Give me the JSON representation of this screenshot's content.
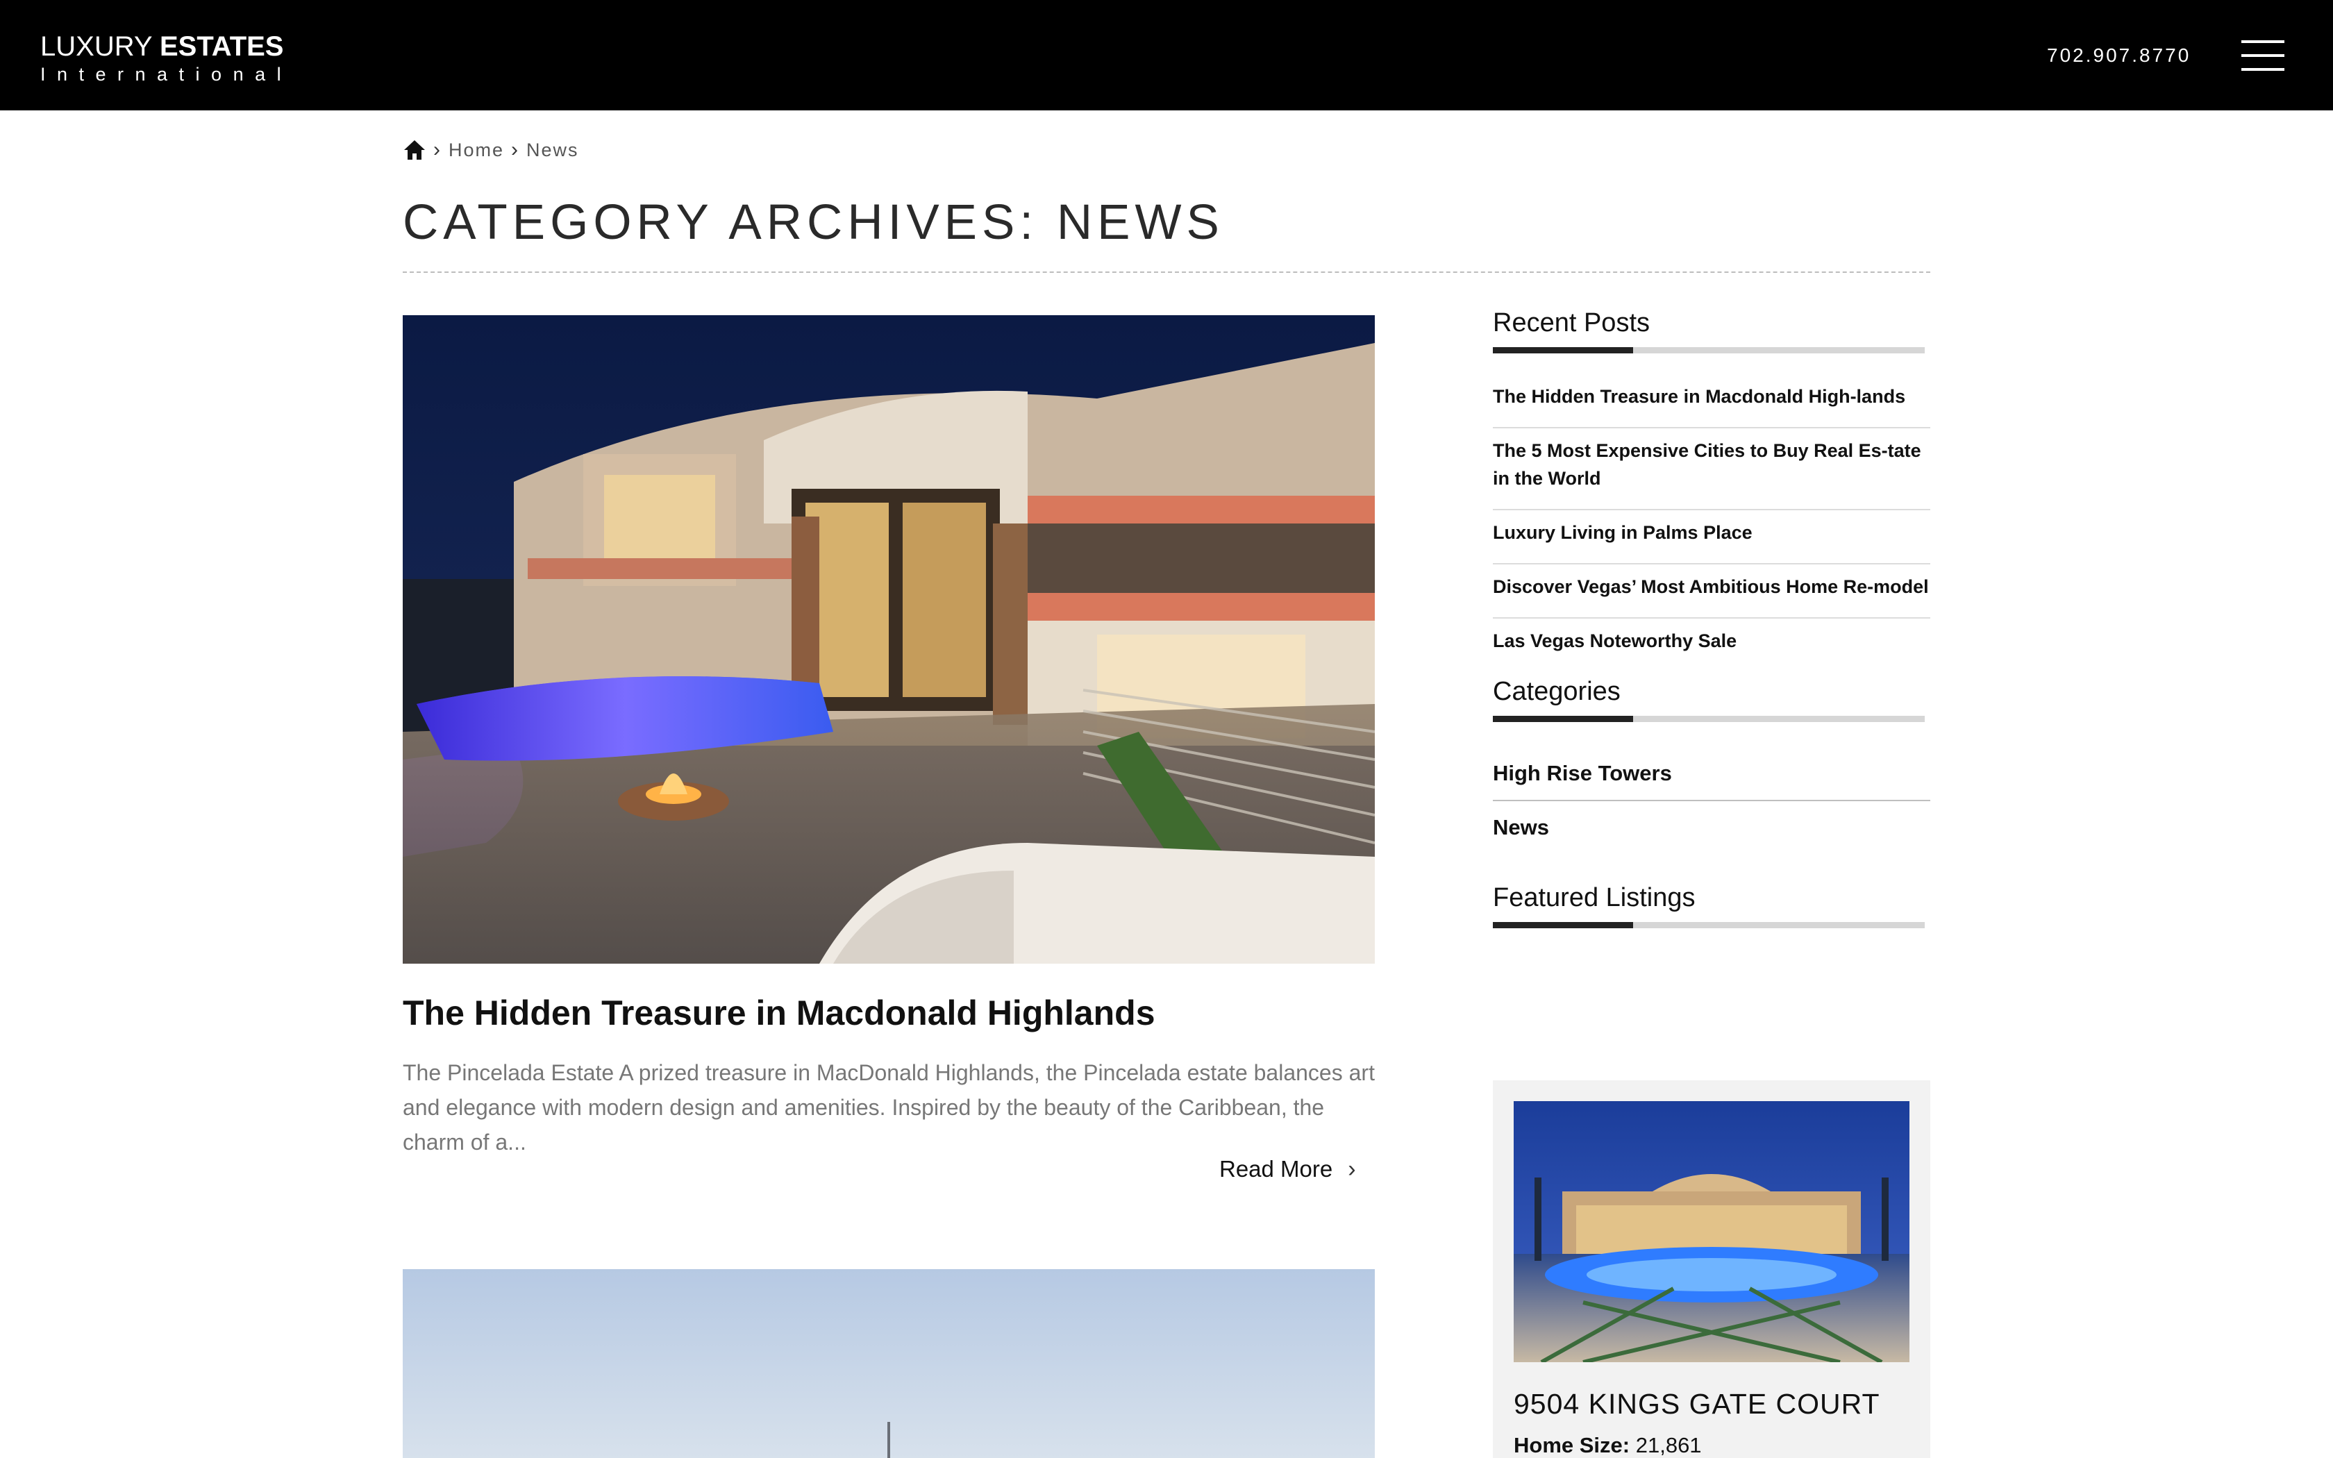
{
  "header": {
    "logo_line1_light": "LUXURY",
    "logo_line1_bold": "ESTATES",
    "logo_line2": "International",
    "phone": "702.907.8770",
    "menu_icon": "hamburger-menu-icon"
  },
  "breadcrumb": {
    "home_icon": "home-icon",
    "items": [
      "Home",
      "News"
    ],
    "separator_icon": "chevron-right-icon"
  },
  "page_title": "CATEGORY ARCHIVES: NEWS",
  "posts": [
    {
      "title": "The Hidden Treasure in Macdonald Highlands",
      "excerpt": "The Pincelada Estate A prized treasure in MacDonald Highlands, the Pincelada estate balances art and elegance with modern design and amenities. Inspired by the beauty of the Caribbean, the charm of a...",
      "read_more": "Read More"
    }
  ],
  "sidebar": {
    "recent_heading": "Recent Posts",
    "recent_posts": [
      "The Hidden Treasure in Macdonald High-lands",
      "The 5 Most Expensive Cities to Buy Real Es-tate in the World",
      "Luxury Living in Palms Place",
      "Discover Vegas’ Most Ambitious Home Re-model",
      "Las Vegas Noteworthy Sale"
    ],
    "categories_heading": "Categories",
    "categories": [
      "High Rise Towers",
      "News"
    ],
    "featured_heading": "Featured Listings",
    "featured": {
      "title": "9504 KINGS GATE COURT",
      "home_size_label": "Home Size:",
      "home_size_value": "21,861"
    }
  },
  "colors": {
    "header_bg": "#000000",
    "accent_bar": "#222222",
    "bar_track": "#d6d6d6",
    "excerpt_text": "#777777"
  }
}
